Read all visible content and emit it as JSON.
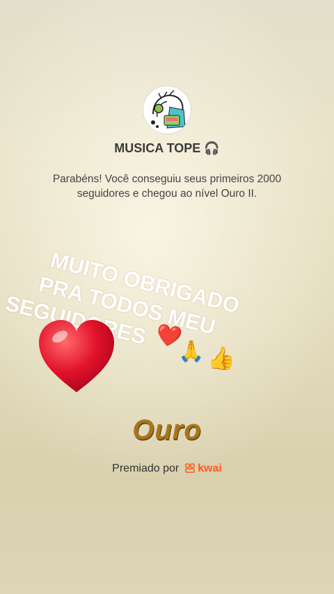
{
  "header": {
    "channel_name": "MUSICA TOPE",
    "channel_emoji": "🎧",
    "avatar_icon": "headphones-listener-icon"
  },
  "message": {
    "text": "Parabéns! Você conseguiu seus primeiros 2000 seguidores e chegou ao nível Ouro II."
  },
  "overlay": {
    "line1": "MUITO OBRIGADO",
    "line2": "PRA TODOS MEU",
    "line3": "SEGUIDORES",
    "emojis": {
      "small_heart": "❤️",
      "pray": "🙏",
      "thumbs_up": "👍"
    }
  },
  "level": {
    "name": "Ouro"
  },
  "award": {
    "label": "Premiado por",
    "brand": "kwai"
  },
  "colors": {
    "gold_text": "#a8751f",
    "brand": "#ff5a1f",
    "heart": "#e3132c"
  }
}
